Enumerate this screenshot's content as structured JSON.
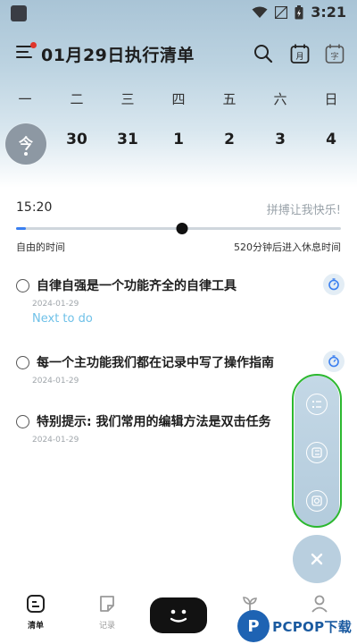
{
  "status_bar": {
    "time": "3:21"
  },
  "header": {
    "title": "01月29日执行清单",
    "calendar_icon_label": "月",
    "calendar2_icon_label": "字"
  },
  "week": {
    "weekday_labels": [
      "一",
      "二",
      "三",
      "四",
      "五",
      "六",
      "日"
    ],
    "dates": [
      "今",
      "30",
      "31",
      "1",
      "2",
      "3",
      "4"
    ]
  },
  "timeline": {
    "current_time": "15:20",
    "motto": "拼搏让我快乐!",
    "left_label": "自由的时间",
    "right_label": "520分钟后进入休息时间",
    "progress_fraction": 0.51,
    "elapsed_fraction": 0.03
  },
  "tasks": [
    {
      "title": "自律自强是一个功能齐全的自律工具",
      "date": "2024-01-29",
      "note": "Next to do",
      "has_timer": true
    },
    {
      "title": "每一个主功能我们都在记录中写了操作指南",
      "date": "2024-01-29",
      "note": "",
      "has_timer": true
    },
    {
      "title": "特别提示: 我们常用的编辑方法是双击任务",
      "date": "2024-01-29",
      "note": "",
      "has_timer": false
    }
  ],
  "bottom_nav": {
    "items": [
      {
        "label": "清单",
        "icon": "list-icon",
        "active": true
      },
      {
        "label": "记录",
        "icon": "note-icon",
        "active": false
      },
      {
        "label": "",
        "icon": "face-icon",
        "active": false
      },
      {
        "label": "",
        "icon": "sprout-icon",
        "active": false
      },
      {
        "label": "",
        "icon": "profile-icon",
        "active": false
      }
    ]
  },
  "watermark": {
    "text": "PCPOP下载",
    "badge": "P"
  },
  "colors": {
    "accent_blue": "#3a7ff0",
    "note_blue": "#6fc1e8",
    "highlight_green": "#2cb82f",
    "red_dot": "#e0352b"
  }
}
